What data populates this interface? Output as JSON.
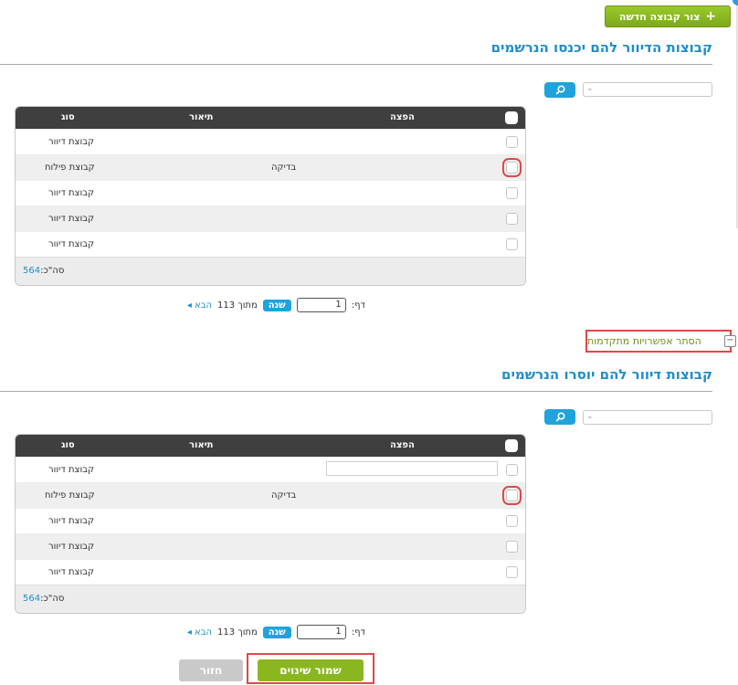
{
  "toolbar": {
    "new_group_label": "צור קבוצה חדשה"
  },
  "section1": {
    "title": "קבוצות הדיוור להם יכנסו הנרשמים",
    "grid": {
      "headers": {
        "type": "סוג",
        "description": "תיאור",
        "distribution": "הפצה"
      },
      "rows": [
        {
          "type": "קבוצת דיוור",
          "description": ""
        },
        {
          "type": "קבוצת פילוח",
          "description": "בדיקה"
        },
        {
          "type": "קבוצת דיוור",
          "description": ""
        },
        {
          "type": "קבוצת דיוור",
          "description": ""
        },
        {
          "type": "קבוצת דיוור",
          "description": ""
        }
      ],
      "total_label": "סה\"כ:",
      "total_value": "564"
    },
    "pager": {
      "page_label": "דף:",
      "page_value": "1",
      "go_label": "שנה",
      "of_label": "מתוך 113",
      "next_label": "הבא"
    }
  },
  "advanced": {
    "toggle_label": "הסתר אפשרויות מתקדמות"
  },
  "section2": {
    "title": "קבוצות דיוור להם יוסרו הנרשמים",
    "grid": {
      "headers": {
        "type": "סוג",
        "description": "תיאור",
        "distribution": "הפצה"
      },
      "rows": [
        {
          "type": "קבוצת דיוור",
          "description": ""
        },
        {
          "type": "קבוצת פילוח",
          "description": "בדיקה"
        },
        {
          "type": "קבוצת דיוור",
          "description": ""
        },
        {
          "type": "קבוצת דיוור",
          "description": ""
        },
        {
          "type": "קבוצת דיוור",
          "description": ""
        }
      ],
      "total_label": "סה\"כ:",
      "total_value": "564"
    },
    "pager": {
      "page_label": "דף:",
      "page_value": "1",
      "go_label": "שנה",
      "of_label": "מתוך 113",
      "next_label": "הבא"
    }
  },
  "actions": {
    "save_label": "שמור שינוים",
    "back_label": "חזור"
  },
  "colors": {
    "accent": "#1f8dc8",
    "green": "#8ab71f",
    "highlight": "#e04848"
  }
}
